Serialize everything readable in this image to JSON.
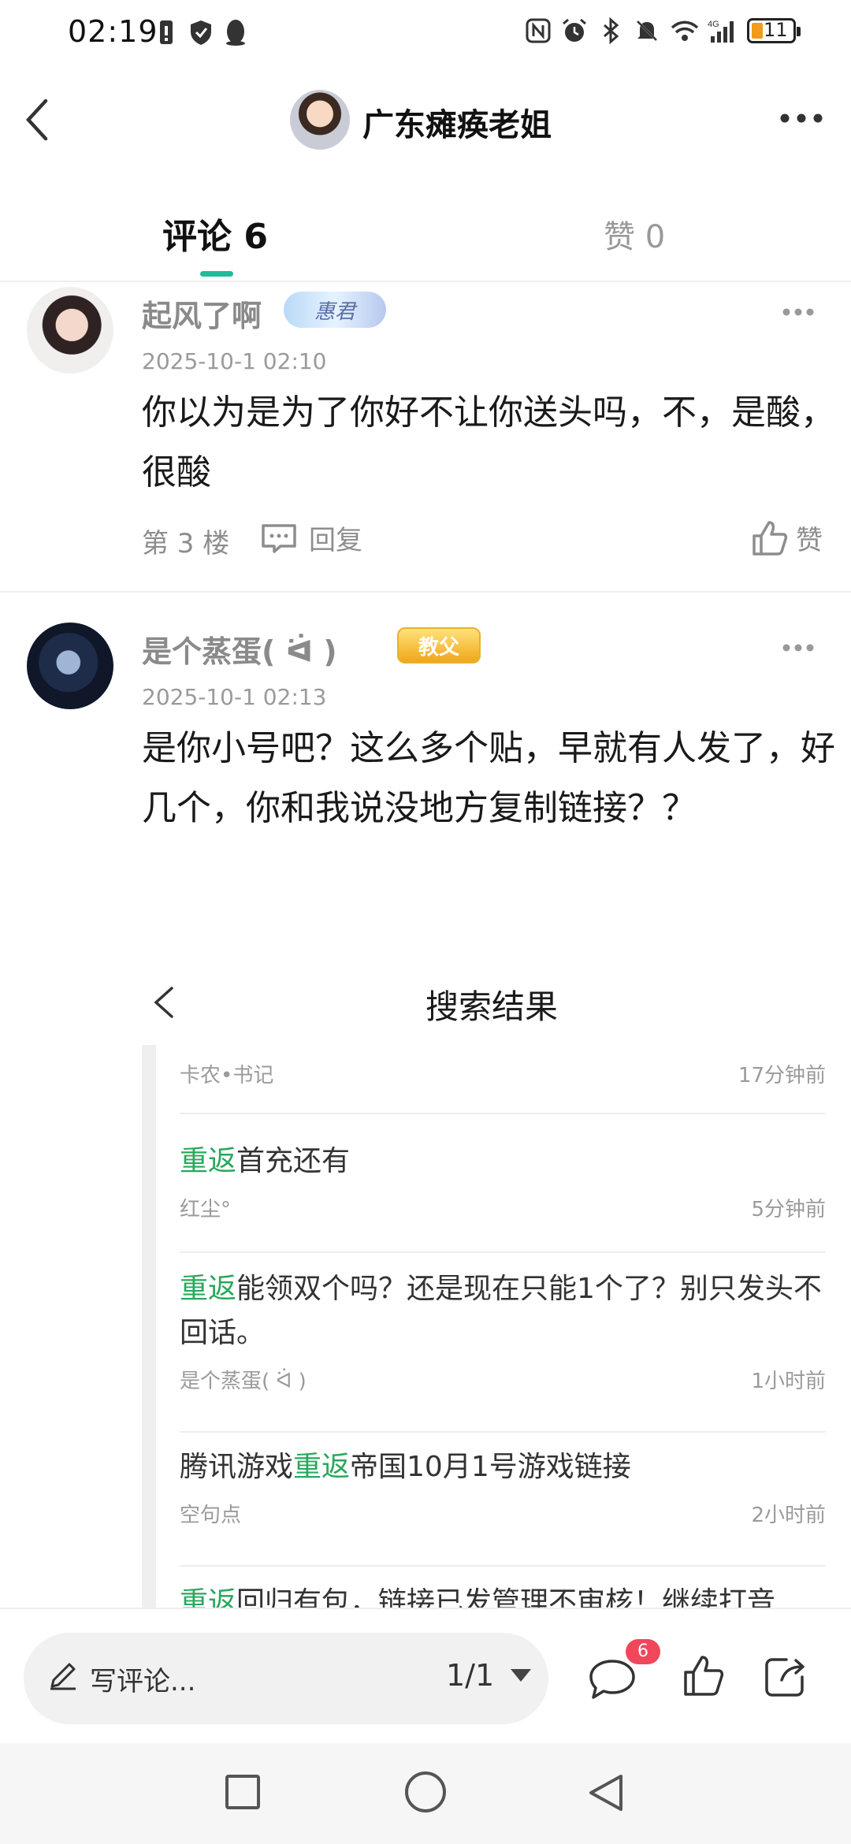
{
  "status_bar": {
    "time": "02:19",
    "battery": "11"
  },
  "header": {
    "title": "广东瘫痪老姐"
  },
  "tabs": {
    "comments": "评论 6",
    "likes": "赞 0"
  },
  "comments": [
    {
      "name": "起风了啊",
      "badge": "惠君",
      "time": "2025-10-1 02:10",
      "text": "你以为是为了你好不让你送头吗，不，是酸，很酸",
      "floor": "第 3 楼",
      "reply_label": "回复",
      "like_label": "赞"
    },
    {
      "name": "是个蒸蛋( ᐛ )",
      "badge": "教父",
      "time": "2025-10-1 02:13",
      "text": "是你小号吧？这么多个贴，早就有人发了，好几个，你和我说没地方复制链接？？"
    }
  ],
  "embedded": {
    "title": "搜索结果",
    "items": [
      {
        "title_pre": "",
        "title_hl": "",
        "title_post": "",
        "author": "卡农•书记",
        "time": "17分钟前"
      },
      {
        "title_pre": "",
        "title_hl": "重返",
        "title_post": "首充还有",
        "author": "红尘°",
        "time": "5分钟前"
      },
      {
        "title_pre": "",
        "title_hl": "重返",
        "title_post": "能领双个吗？还是现在只能1个了？别只发头不回话。",
        "author": "是个蒸蛋( ᐛ )",
        "time": "1小时前"
      },
      {
        "title_pre": "腾讯游戏",
        "title_hl": "重返",
        "title_post": "帝国10月1号游戏链接",
        "author": "空句点",
        "time": "2小时前"
      },
      {
        "title_pre": "",
        "title_hl": "重返",
        "title_post": "回归有包，链接已发管理不审核！继续打音",
        "author": "",
        "time": ""
      }
    ]
  },
  "bottom_bar": {
    "write_placeholder": "写评论...",
    "page": "1/1",
    "comment_count": "6"
  },
  "colors": {
    "accent": "#1fbc98",
    "highlight": "#28a85c",
    "badge": "#f0475a"
  }
}
